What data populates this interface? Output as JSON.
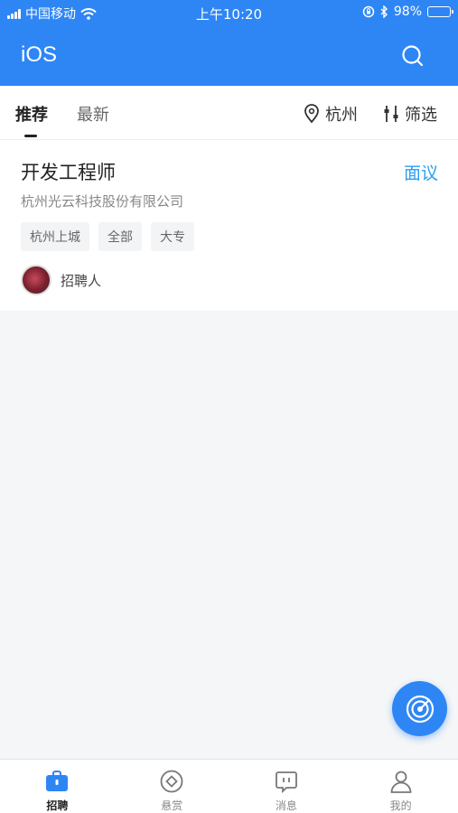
{
  "status_bar": {
    "carrier": "中国移动",
    "time": "上午10:20",
    "battery": "98%",
    "battery_level": 0.98
  },
  "header": {
    "title": "iOS",
    "search_icon": "search-icon"
  },
  "tabs": [
    {
      "label": "推荐",
      "active": true
    },
    {
      "label": "最新",
      "active": false
    }
  ],
  "filters": {
    "location": "杭州",
    "filter": "筛选"
  },
  "job": {
    "title": "开发工程师",
    "salary": "面议",
    "company": "杭州光云科技股份有限公司",
    "tags": [
      "杭州上城",
      "全部",
      "大专"
    ],
    "recruiter": "招聘人"
  },
  "bottom_nav": [
    {
      "label": "招聘",
      "icon": "briefcase-icon",
      "active": true
    },
    {
      "label": "悬赏",
      "icon": "reward-icon",
      "active": false
    },
    {
      "label": "消息",
      "icon": "message-icon",
      "active": false
    },
    {
      "label": "我的",
      "icon": "user-icon",
      "active": false
    }
  ],
  "colors": {
    "primary": "#2e86f5",
    "salary": "#2a9ef5"
  }
}
